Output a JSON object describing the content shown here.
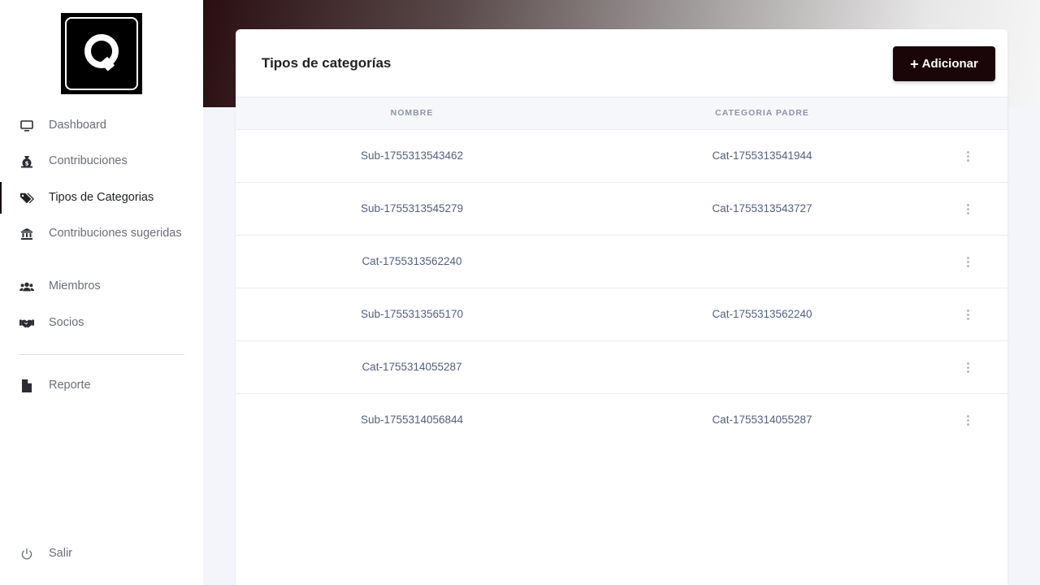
{
  "logo": {
    "letter": "Q"
  },
  "sidebar": {
    "items": [
      {
        "label": "Dashboard",
        "icon": "monitor-icon"
      },
      {
        "label": "Contribuciones",
        "icon": "money-bag-icon"
      },
      {
        "label": "Tipos de Categorias",
        "icon": "tags-icon"
      },
      {
        "label": "Contribuciones sugeridas",
        "icon": "bank-icon"
      },
      {
        "label": "Miembros",
        "icon": "users-icon"
      },
      {
        "label": "Socios",
        "icon": "handshake-icon"
      },
      {
        "label": "Reporte",
        "icon": "file-icon"
      }
    ],
    "active": "Tipos de Categorias",
    "logout": {
      "label": "Salir",
      "icon": "power-icon"
    }
  },
  "card": {
    "title": "Tipos de categorías",
    "add_label": "Adicionar",
    "columns": [
      "NOMBRE",
      "CATEGORIA PADRE"
    ],
    "rows": [
      {
        "nombre": "Sub-1755313543462",
        "padre": "Cat-1755313541944"
      },
      {
        "nombre": "Sub-1755313545279",
        "padre": "Cat-1755313543727"
      },
      {
        "nombre": "Cat-1755313562240",
        "padre": ""
      },
      {
        "nombre": "Sub-1755313565170",
        "padre": "Cat-1755313562240"
      },
      {
        "nombre": "Cat-1755314055287",
        "padre": ""
      },
      {
        "nombre": "Sub-1755314056844",
        "padre": "Cat-1755314055287"
      }
    ]
  },
  "colors": {
    "accent": "#1a0508",
    "sidebar_bg": "#ffffff",
    "page_bg": "#f4f5fa"
  }
}
